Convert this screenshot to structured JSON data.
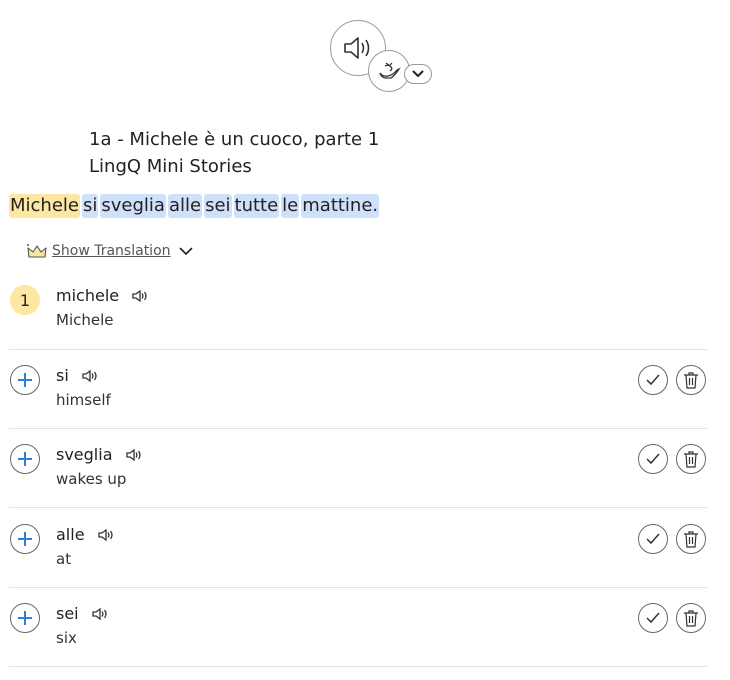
{
  "icons": {
    "audio": "speaker-icon",
    "voice": "genie-lamp-icon",
    "dropdown": "chevron-down-icon",
    "crown": "crown-icon",
    "add": "plus-icon",
    "known": "check-icon",
    "delete": "trash-icon"
  },
  "colors": {
    "highlight_level": "#fde7a3",
    "highlight_new": "#cfe0fb",
    "plus_blue": "#2d7fdb"
  },
  "lesson": {
    "title": "1a - Michele è un cuoco, parte 1",
    "course": "LingQ Mini Stories"
  },
  "sentence": {
    "words": [
      {
        "text": "Michele",
        "status": "level"
      },
      {
        "text": "si",
        "status": "new"
      },
      {
        "text": "sveglia",
        "status": "new"
      },
      {
        "text": "alle",
        "status": "new"
      },
      {
        "text": "sei",
        "status": "new"
      },
      {
        "text": "tutte",
        "status": "new"
      },
      {
        "text": "le",
        "status": "new"
      },
      {
        "text": "mattine.",
        "status": "new"
      }
    ]
  },
  "translation": {
    "label": "Show Translation"
  },
  "rows": [
    {
      "status": "1",
      "term": "michele",
      "meaning": "Michele"
    },
    {
      "term": "si",
      "meaning": "himself"
    },
    {
      "term": "sveglia",
      "meaning": "wakes up"
    },
    {
      "term": "alle",
      "meaning": "at"
    },
    {
      "term": "sei",
      "meaning": "six"
    }
  ]
}
